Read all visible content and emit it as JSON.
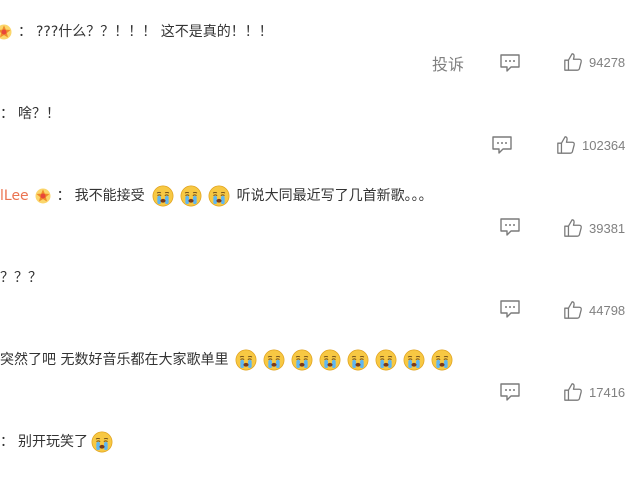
{
  "report_label": "投诉",
  "comments": [
    {
      "user": "",
      "separator": "：",
      "has_badge": true,
      "segments": [
        "???什么？？！！！ 这不是真的！！！"
      ],
      "likes": "94278",
      "show_report": true
    },
    {
      "user": "",
      "separator": "：",
      "has_badge": false,
      "segments": [
        "啥？！"
      ],
      "likes": "102364",
      "show_report": false
    },
    {
      "user": "lLee",
      "separator": "：",
      "has_badge": true,
      "segments": [
        "我不能接受",
        "听说大同最近写了几首新歌。。。"
      ],
      "emoji_count": 3,
      "likes": "39381",
      "show_report": false
    },
    {
      "user": "",
      "separator": "",
      "has_badge": false,
      "segments": [
        "？？？"
      ],
      "likes": "44798",
      "show_report": false
    },
    {
      "user": "",
      "separator": "",
      "has_badge": false,
      "segments": [
        "突然了吧 无数好音乐都在大家歌单里"
      ],
      "emoji_count": 8,
      "likes": "17416",
      "show_report": false
    },
    {
      "user": "",
      "separator": "：",
      "has_badge": false,
      "segments": [
        "别开玩笑了"
      ],
      "emoji_count": 1,
      "show_report": false
    }
  ],
  "icons": {
    "reply": "comment-icon",
    "like": "thumbs-up-icon",
    "emoji": "crying-face-emoji",
    "badge": "vip-badge-icon"
  },
  "colors": {
    "username": "#eb7350",
    "text": "#333333",
    "meta": "#808080"
  }
}
